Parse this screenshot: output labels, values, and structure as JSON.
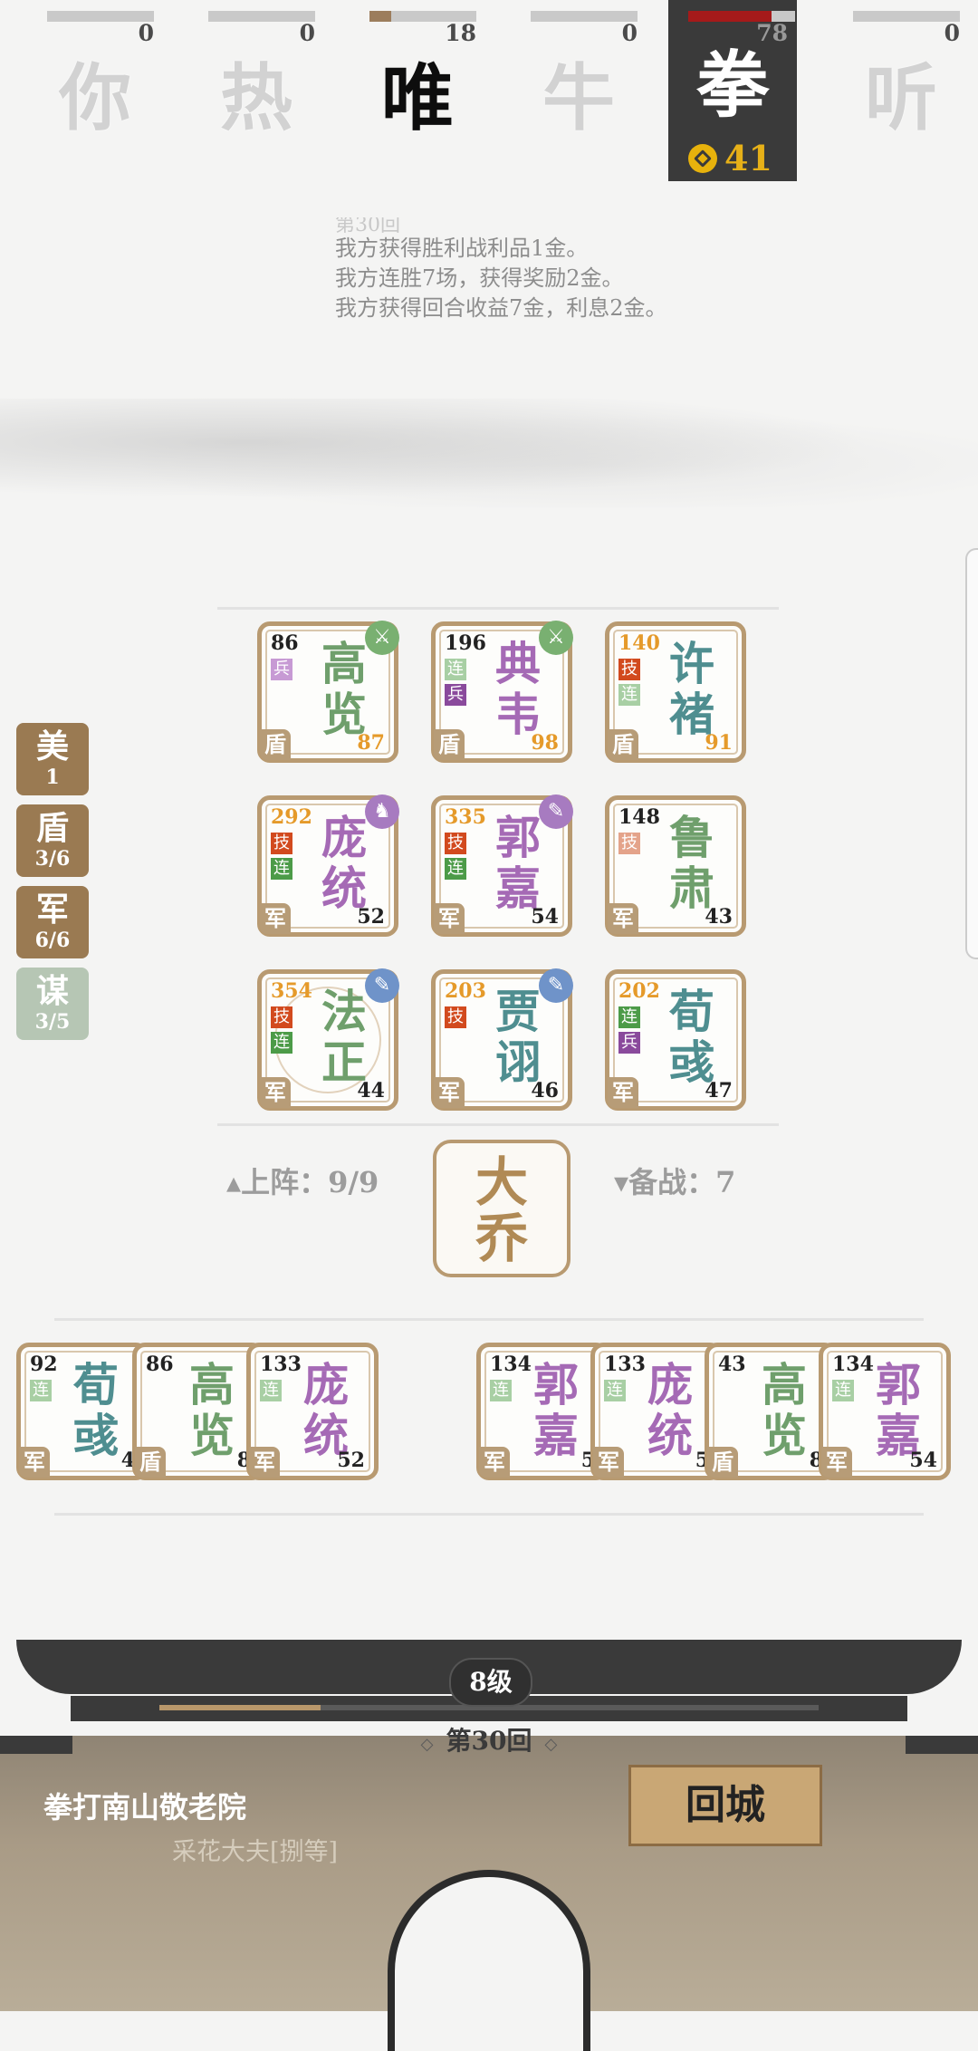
{
  "players": [
    {
      "glyph": "你",
      "hp": "0",
      "hp_pct": 1.0,
      "state": "dim",
      "bar_color": "#c9c9c9"
    },
    {
      "glyph": "热",
      "hp": "0",
      "hp_pct": 1.0,
      "state": "dim",
      "bar_color": "#c9c9c9"
    },
    {
      "glyph": "唯",
      "hp": "18",
      "hp_pct": 0.2,
      "state": "active",
      "bar_color": "#9c7d5c"
    },
    {
      "glyph": "牛",
      "hp": "0",
      "hp_pct": 1.0,
      "state": "dim",
      "bar_color": "#c9c9c9"
    },
    {
      "glyph": "拳",
      "hp": "78",
      "hp_pct": 0.78,
      "state": "me",
      "bar_color": "#a51a1a",
      "gold": "41"
    },
    {
      "glyph": "听",
      "hp": "0",
      "hp_pct": 1.0,
      "state": "dim",
      "bar_color": "#c9c9c9"
    }
  ],
  "log": {
    "faint": "第30回",
    "lines": [
      "我方获得胜利战利品1金。",
      "我方连胜7场，获得奖励2金。",
      "我方获得回合收益7金，利息2金。"
    ]
  },
  "side_tags": [
    {
      "label": "美",
      "count": "1",
      "style": "brown"
    },
    {
      "label": "盾",
      "count": "3/6",
      "style": "brown"
    },
    {
      "label": "军",
      "count": "6/6",
      "style": "brown"
    },
    {
      "label": "谋",
      "count": "3/5",
      "style": "green"
    }
  ],
  "board": [
    {
      "name": "高览",
      "num": "86",
      "lvl": "87",
      "role": "盾",
      "color": "green-n",
      "badges": [
        {
          "t": "兵",
          "c": "#c79ad4"
        }
      ],
      "equip": "#79b071",
      "equip_icon": "⚔",
      "num_orange": false,
      "lvl_orange": true
    },
    {
      "name": "典韦",
      "num": "196",
      "lvl": "98",
      "role": "盾",
      "color": "purple-n",
      "badges": [
        {
          "t": "连",
          "c": "#a8cfa4"
        },
        {
          "t": "兵",
          "c": "#8a4a9c"
        }
      ],
      "equip": "#79b071",
      "equip_icon": "⚔",
      "num_orange": false,
      "lvl_orange": true
    },
    {
      "name": "许褚",
      "num": "140",
      "lvl": "91",
      "role": "盾",
      "color": "teal-n",
      "badges": [
        {
          "t": "技",
          "c": "#d24a1e"
        },
        {
          "t": "连",
          "c": "#a8cfa4"
        }
      ],
      "equip": "",
      "equip_icon": "",
      "num_orange": true,
      "lvl_orange": true
    },
    {
      "name": "庞统",
      "num": "292",
      "lvl": "52",
      "role": "军",
      "color": "purple-n",
      "badges": [
        {
          "t": "技",
          "c": "#d24a1e"
        },
        {
          "t": "连",
          "c": "#4c9b48"
        }
      ],
      "equip": "#a77bc0",
      "equip_icon": "♞",
      "num_orange": true,
      "lvl_orange": false
    },
    {
      "name": "郭嘉",
      "num": "335",
      "lvl": "54",
      "role": "军",
      "color": "purple-n",
      "badges": [
        {
          "t": "技",
          "c": "#d24a1e"
        },
        {
          "t": "连",
          "c": "#4c9b48"
        }
      ],
      "equip": "#a77bc0",
      "equip_icon": "✎",
      "num_orange": true,
      "lvl_orange": false
    },
    {
      "name": "鲁肃",
      "num": "148",
      "lvl": "43",
      "role": "军",
      "color": "green-n",
      "badges": [
        {
          "t": "技",
          "c": "#e4a38a"
        }
      ],
      "equip": "",
      "equip_icon": "",
      "num_orange": false,
      "lvl_orange": false
    },
    {
      "name": "法正",
      "num": "354",
      "lvl": "44",
      "role": "军",
      "color": "green-n",
      "badges": [
        {
          "t": "技",
          "c": "#d24a1e"
        },
        {
          "t": "连",
          "c": "#4c9b48"
        }
      ],
      "equip": "#6f93c9",
      "equip_icon": "✎",
      "num_orange": true,
      "lvl_orange": false,
      "ring": true
    },
    {
      "name": "贾诩",
      "num": "203",
      "lvl": "46",
      "role": "军",
      "color": "teal-n",
      "badges": [
        {
          "t": "技",
          "c": "#d24a1e"
        }
      ],
      "equip": "#6f93c9",
      "equip_icon": "✎",
      "num_orange": true,
      "lvl_orange": false
    },
    {
      "name": "荀彧",
      "num": "202",
      "lvl": "47",
      "role": "军",
      "color": "teal-n",
      "badges": [
        {
          "t": "连",
          "c": "#4c9b48"
        },
        {
          "t": "兵",
          "c": "#8a4a9c"
        }
      ],
      "equip": "",
      "equip_icon": "",
      "num_orange": true,
      "lvl_orange": false
    }
  ],
  "deploy_label": "▴上阵：9/9",
  "reserve_label": "▾备战：7",
  "boss": "大乔",
  "bench": [
    {
      "name": "荀彧",
      "num": "92",
      "lvl": "4",
      "role": "军",
      "color": "teal-n",
      "badge": "连"
    },
    {
      "name": "高览",
      "num": "86",
      "lvl": "8",
      "role": "盾",
      "color": "green-n",
      "badge": ""
    },
    {
      "name": "庞统",
      "num": "133",
      "lvl": "52",
      "role": "军",
      "color": "purple-n",
      "badge": "连"
    },
    {
      "name": "郭嘉",
      "num": "134",
      "lvl": "5",
      "role": "军",
      "color": "purple-n",
      "badge": "连"
    },
    {
      "name": "庞统",
      "num": "133",
      "lvl": "5",
      "role": "军",
      "color": "purple-n",
      "badge": "连"
    },
    {
      "name": "高览",
      "num": "43",
      "lvl": "8",
      "role": "盾",
      "color": "green-n",
      "badge": ""
    },
    {
      "name": "郭嘉",
      "num": "134",
      "lvl": "54",
      "role": "军",
      "color": "purple-n",
      "badge": "连"
    }
  ],
  "level": "8级",
  "xp_pct": 0.245,
  "round": "第30回",
  "stage_name": "拳打南山敬老院",
  "rank": "采花大夫[捌等]",
  "back_button": "回城"
}
